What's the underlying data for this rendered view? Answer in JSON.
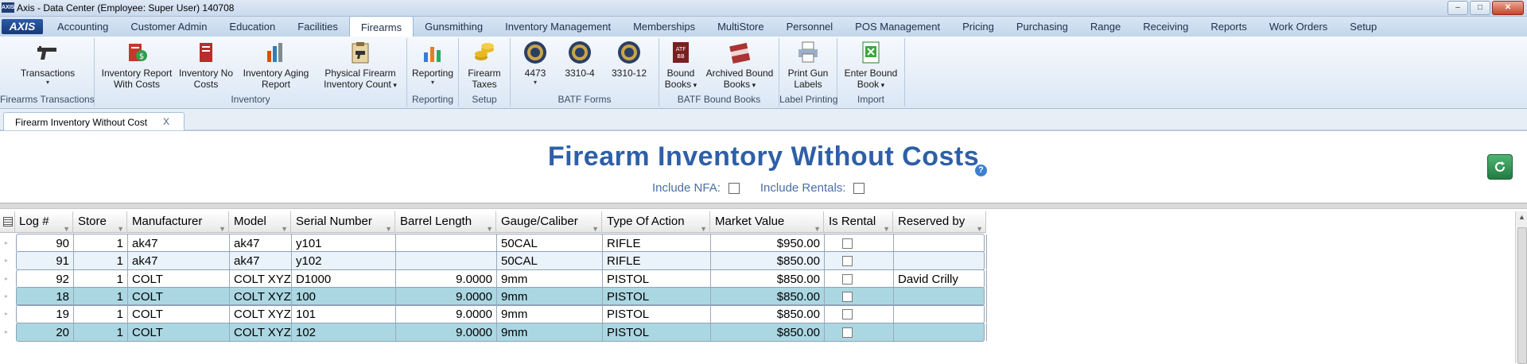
{
  "window": {
    "logo": "AXIS",
    "title": "Axis - Data Center  (Employee: Super User) 140708",
    "controls": [
      "–",
      "□",
      "✕"
    ]
  },
  "app": {
    "logo": "AXIS"
  },
  "menu": {
    "tabs": [
      {
        "label": "Accounting"
      },
      {
        "label": "Customer Admin"
      },
      {
        "label": "Education"
      },
      {
        "label": "Facilities"
      },
      {
        "label": "Firearms"
      },
      {
        "label": "Gunsmithing"
      },
      {
        "label": "Inventory Management"
      },
      {
        "label": "Memberships"
      },
      {
        "label": "MultiStore"
      },
      {
        "label": "Personnel"
      },
      {
        "label": "POS Management"
      },
      {
        "label": "Pricing"
      },
      {
        "label": "Purchasing"
      },
      {
        "label": "Range"
      },
      {
        "label": "Receiving"
      },
      {
        "label": "Reports"
      },
      {
        "label": "Work Orders"
      },
      {
        "label": "Setup"
      }
    ],
    "active": "Firearms"
  },
  "ribbon": {
    "groups": [
      {
        "label": "Firearms Transactions",
        "buttons": [
          {
            "line1": "Transactions",
            "line2": "",
            "dropdown": true,
            "icon": "pistol-icon"
          }
        ]
      },
      {
        "label": "Inventory",
        "buttons": [
          {
            "line1": "Inventory Report",
            "line2": "With Costs",
            "dropdown": false,
            "icon": "report-costs-icon"
          },
          {
            "line1": "Inventory No",
            "line2": "Costs",
            "dropdown": false,
            "icon": "report-nocosts-icon"
          },
          {
            "line1": "Inventory Aging",
            "line2": "Report",
            "dropdown": false,
            "icon": "aging-report-icon"
          },
          {
            "line1": "Physical Firearm",
            "line2": "Inventory Count",
            "dropdown": true,
            "icon": "clipboard-icon"
          }
        ]
      },
      {
        "label": "Reporting",
        "buttons": [
          {
            "line1": "Reporting",
            "line2": "",
            "dropdown": true,
            "icon": "bar-chart-icon"
          }
        ]
      },
      {
        "label": "Setup",
        "buttons": [
          {
            "line1": "Firearm",
            "line2": "Taxes",
            "dropdown": false,
            "icon": "coins-icon"
          }
        ]
      },
      {
        "label": "BATF Forms",
        "buttons": [
          {
            "line1": "4473",
            "line2": "",
            "dropdown": true,
            "icon": "seal-icon"
          },
          {
            "line1": "3310-4",
            "line2": "",
            "dropdown": false,
            "icon": "seal-icon"
          },
          {
            "line1": "3310-12",
            "line2": "",
            "dropdown": false,
            "icon": "seal-icon"
          }
        ]
      },
      {
        "label": "BATF Bound Books",
        "buttons": [
          {
            "line1": "Bound",
            "line2": "Books",
            "dropdown": true,
            "icon": "bound-book-icon"
          },
          {
            "line1": "Archived Bound",
            "line2": "Books",
            "dropdown": true,
            "icon": "archived-book-icon"
          }
        ]
      },
      {
        "label": "Label Printing",
        "buttons": [
          {
            "line1": "Print Gun",
            "line2": "Labels",
            "dropdown": false,
            "icon": "printer-icon"
          }
        ]
      },
      {
        "label": "Import",
        "buttons": [
          {
            "line1": "Enter Bound",
            "line2": "Book",
            "dropdown": true,
            "icon": "excel-import-icon"
          }
        ]
      }
    ]
  },
  "doc_tab": {
    "label": "Firearm Inventory Without Cost",
    "close": "X"
  },
  "report": {
    "title": "Firearm Inventory Without Costs",
    "help": "?",
    "include_nfa_label": "Include NFA:",
    "include_rentals_label": "Include Rentals:"
  },
  "grid": {
    "columns": [
      "Log #",
      "Store",
      "Manufacturer",
      "Model",
      "Serial Number",
      "Barrel Length",
      "Gauge/Caliber",
      "Type Of Action",
      "Market Value",
      "Is Rental",
      "Reserved by"
    ],
    "rows": [
      {
        "log": "90",
        "store": "1",
        "manufacturer": "ak47",
        "model": "ak47",
        "serial": "y101",
        "barrel": "",
        "gauge": "50CAL",
        "action": "RIFLE",
        "value": "$950.00",
        "rental": false,
        "reserved": ""
      },
      {
        "log": "91",
        "store": "1",
        "manufacturer": "ak47",
        "model": "ak47",
        "serial": "y102",
        "barrel": "",
        "gauge": "50CAL",
        "action": "RIFLE",
        "value": "$850.00",
        "rental": false,
        "reserved": ""
      },
      {
        "log": "92",
        "store": "1",
        "manufacturer": "COLT",
        "model": "COLT XYZ",
        "serial": "D1000",
        "barrel": "9.0000",
        "gauge": "9mm",
        "action": "PISTOL",
        "value": "$850.00",
        "rental": false,
        "reserved": "David Crilly"
      },
      {
        "log": "18",
        "store": "1",
        "manufacturer": "COLT",
        "model": "COLT XYZ",
        "serial": "100",
        "barrel": "9.0000",
        "gauge": "9mm",
        "action": "PISTOL",
        "value": "$850.00",
        "rental": false,
        "reserved": ""
      },
      {
        "log": "19",
        "store": "1",
        "manufacturer": "COLT",
        "model": "COLT XYZ",
        "serial": "101",
        "barrel": "9.0000",
        "gauge": "9mm",
        "action": "PISTOL",
        "value": "$850.00",
        "rental": false,
        "reserved": ""
      },
      {
        "log": "20",
        "store": "1",
        "manufacturer": "COLT",
        "model": "COLT XYZ",
        "serial": "102",
        "barrel": "9.0000",
        "gauge": "9mm",
        "action": "PISTOL",
        "value": "$850.00",
        "rental": false,
        "reserved": ""
      }
    ]
  }
}
